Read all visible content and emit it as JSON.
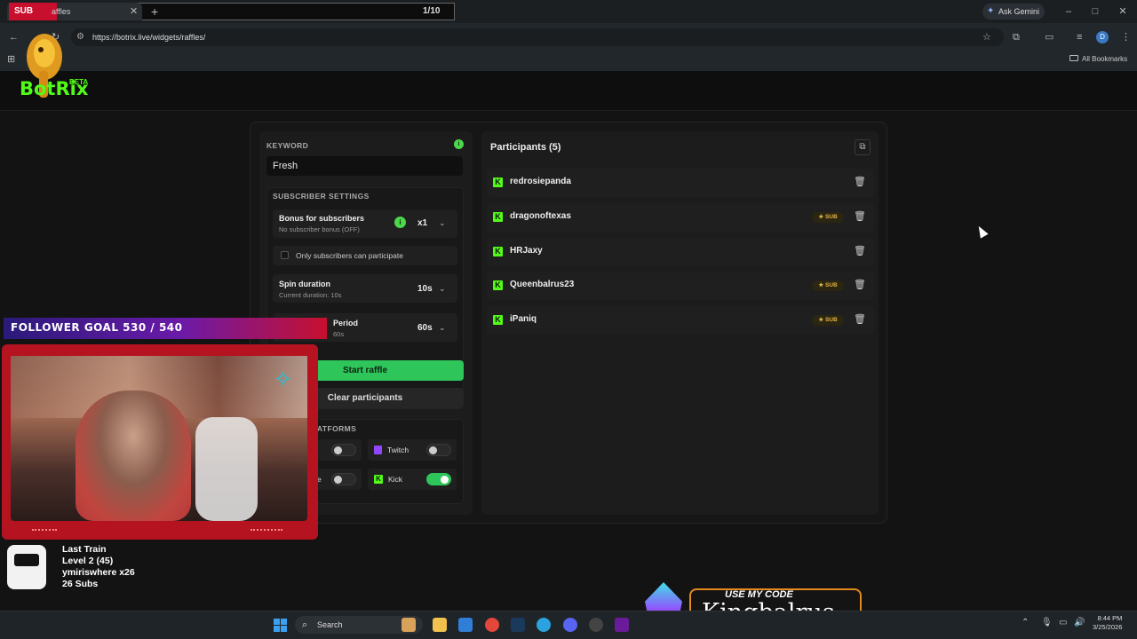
{
  "browser": {
    "sub_goal": "SUB GOAL",
    "tab_title": "affles",
    "goal_counter": "1/10",
    "url": "https://botrix.live/widgets/raffles/",
    "ask_gemini": "Ask Gemini",
    "all_bookmarks": "All Bookmarks",
    "profile_initial": "D",
    "win_minimize": "–",
    "win_maximize": "□",
    "win_close": "✕"
  },
  "app": {
    "logo": "BotRix",
    "beta": "BETA"
  },
  "raffle": {
    "keyword_label": "KEYWORD",
    "keyword_value": "Fresh",
    "subscriber_settings_label": "SUBSCRIBER SETTINGS",
    "bonus_title": "Bonus for subscribers",
    "bonus_sub": "No subscriber bonus (OFF)",
    "bonus_value": "x1",
    "only_subs_label": "Only subscribers can participate",
    "spin_title": "Spin duration",
    "spin_sub": "Current duration: 10s",
    "spin_value": "10s",
    "period_title": "Period",
    "period_sub": "60s",
    "period_value": "60s",
    "start_label": "Start raffle",
    "clear_label": "Clear participants",
    "platforms_label": "ATFORMS",
    "platforms": [
      {
        "name": "",
        "enabled": false
      },
      {
        "name": "Twitch",
        "enabled": false
      },
      {
        "name": "e",
        "enabled": false
      },
      {
        "name": "Kick",
        "enabled": true
      }
    ]
  },
  "participants": {
    "title": "Participants (5)",
    "sub_badge": "★ SUB",
    "items": [
      {
        "name": "redrosiepanda",
        "sub": false
      },
      {
        "name": "dragonoftexas",
        "sub": true
      },
      {
        "name": "HRJaxy",
        "sub": false
      },
      {
        "name": "Queenbalrus23",
        "sub": true
      },
      {
        "name": "iPaniq",
        "sub": true
      }
    ]
  },
  "overlay": {
    "follower_goal": "FOLLOWER GOAL 530 / 540",
    "last_train_lines": [
      "Last Train",
      "Level 2  (45)",
      "ymiriswhere x26",
      "26 Subs"
    ],
    "code_label": "USE MY CODE",
    "code_value": "Kingbalrus"
  },
  "taskbar": {
    "search": "Search",
    "time": "8:44 PM",
    "date": "3/25/2026"
  },
  "colors": {
    "kick_green": "#53fc18",
    "start_button": "#2ec55a",
    "sub_badge": "#e3b341",
    "follower_red": "#c8102e"
  }
}
